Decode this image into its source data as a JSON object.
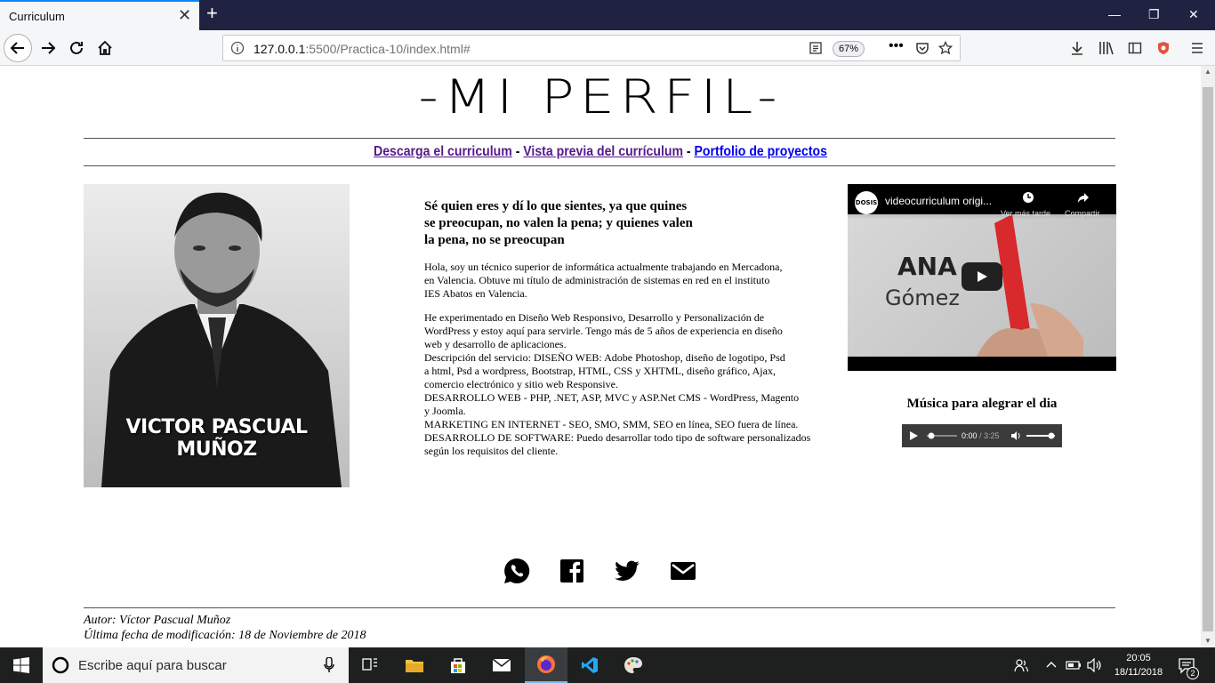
{
  "browser": {
    "tab_title": "Curriculum",
    "url_host": "127.0.0.1",
    "url_path": ":5500/Practica-10/index.html#",
    "zoom": "67%"
  },
  "page": {
    "title": "-MI PERFIL-",
    "links": [
      "Descarga el curriculum",
      "Vista previa del currículum",
      "Portfolio de proyectos"
    ],
    "separator": " - ",
    "photo_name": "VICTOR PASCUAL MUÑOZ",
    "quote_lines": [
      "Sé quien eres y dí lo que sientes, ya que quines",
      "se preocupan, no valen la pena; y quienes valen",
      "la pena, no se preocupan"
    ],
    "bio_p1_lines": [
      "Hola, soy un técnico superior de informática actualmente trabajando en Mercadona,",
      "en Valencia. Obtuve mi título de administración de sistemas en red en el instituto",
      "IES Abatos en Valencia."
    ],
    "bio_p2_lines": [
      "He experimentado en Diseño Web Responsivo, Desarrollo y Personalización de",
      "WordPress y estoy aquí para servirle. Tengo más de 5 años de experiencia en diseño",
      "web y desarrollo de aplicaciones.",
      "Descripción del servicio: DISEÑO WEB: Adobe Photoshop, diseño de logotipo, Psd",
      "a html, Psd a wordpress, Bootstrap, HTML, CSS y XHTML, diseño gráfico, Ajax,",
      "comercio electrónico y sitio web Responsive.",
      "DESARROLLO WEB - PHP, .NET, ASP, MVC y ASP.Net CMS - WordPress, Magento",
      "y Joomla.",
      "MARKETING EN INTERNET - SEO, SMO, SMM, SEO en línea, SEO fuera de línea.",
      "DESARROLLO DE SOFTWARE: Puedo desarrollar todo tipo de software personalizados",
      "según los requisitos del cliente."
    ],
    "video": {
      "channel_logo": "DOSIS",
      "title": "videocurriculum origi...",
      "watch_later": "Ver más tarde",
      "share": "Compartir",
      "thumb_text_1": "ANA",
      "thumb_text_2": "Gómez"
    },
    "music_title": "Música para alegrar el dia",
    "audio": {
      "current": "0:00",
      "duration": "/ 3:25"
    },
    "social_icons": [
      "whatsapp-icon",
      "facebook-icon",
      "twitter-icon",
      "mail-icon"
    ],
    "footer_author": "Autor: Víctor Pascual Muñoz",
    "footer_date": "Última fecha de modificación: 18 de Noviembre de 2018"
  },
  "taskbar": {
    "search_placeholder": "Escribe aquí para buscar",
    "time": "20:05",
    "date": "18/11/2018",
    "notification_count": "2"
  }
}
